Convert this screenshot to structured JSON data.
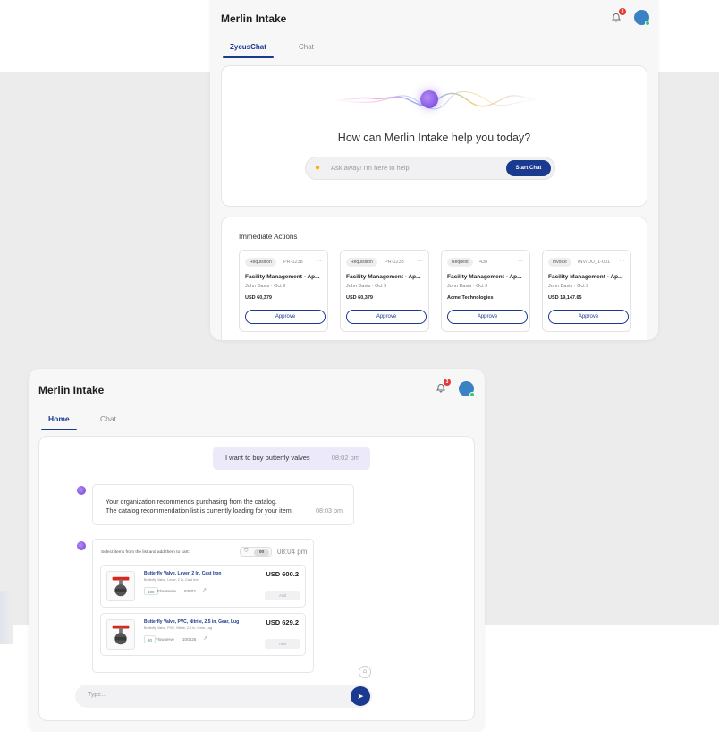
{
  "colors": {
    "accent": "#1a3a8f",
    "badge": "#e53935",
    "online": "#2ecc71",
    "avatar": "#3b82c4"
  },
  "window_a": {
    "title": "Merlin Intake",
    "notification_count": "3",
    "tabs": [
      {
        "label": "ZycusChat",
        "active": true
      },
      {
        "label": "Chat",
        "active": false
      }
    ],
    "hero": {
      "question": "How can Merlin Intake help you today?",
      "placeholder": "Ask away! I'm here to help",
      "start_label": "Start Chat"
    },
    "immediate_actions": {
      "title": "Immediate Actions",
      "cards": [
        {
          "tag": "Requisition",
          "ref": "PR-1238",
          "name": "Facility Management - Ap...",
          "meta": "John Davis · Oct 9",
          "amount": "USD 60,379",
          "approve": "Approve"
        },
        {
          "tag": "Requisition",
          "ref": "PR-1238",
          "name": "Facility Management - Ap...",
          "meta": "John Davis · Oct 9",
          "amount": "USD 60,379",
          "approve": "Approve"
        },
        {
          "tag": "Request",
          "ref": "438",
          "name": "Facility Management - Ap...",
          "meta": "John Davis · Oct 9",
          "amount": "Acme Technologies",
          "approve": "Approve"
        },
        {
          "tag": "Invoice",
          "ref": "INV/OU_1-001",
          "name": "Facility Management - Ap...",
          "meta": "John Davis · Oct 9",
          "amount": "USD 19,147.65",
          "approve": "Approve"
        }
      ]
    }
  },
  "window_b": {
    "title": "Merlin Intake",
    "notification_count": "3",
    "tabs": [
      {
        "label": "Home",
        "active": true
      },
      {
        "label": "Chat",
        "active": false
      }
    ],
    "messages": {
      "user": {
        "text": "I want to buy butterfly valves",
        "time": "08:02 pm"
      },
      "bot": {
        "line1": "Your organization recommends purchasing from the catalog.",
        "line2": "The catalog recommendation list is currently loading for your item.",
        "time": "08:03 pm"
      },
      "catalog": {
        "hint": "Select items from the list and add them to cart:",
        "cart_count": "00",
        "time": "08:04 pm",
        "items": [
          {
            "name": "Butterfly Valve, Lever, 2 In, Cast Iron",
            "desc": "Butterfly Valve, Lever, 2 In, Cast Iron",
            "qty": "100",
            "supplier": "Flowserve",
            "code": "93502",
            "price": "USD 600.2",
            "add": "Add"
          },
          {
            "name": "Butterfly Valve, PVC, Nitrile, 2.5 in, Gear, Lug",
            "desc": "Butterfly Valve, PVC, Nitrile, 2.5 in, Gear, Lug",
            "qty": "90",
            "supplier": "Flowserve",
            "code": "100425",
            "price": "USD 629.2",
            "add": "Add"
          }
        ]
      }
    },
    "input_placeholder": "Type..."
  },
  "icons": {
    "bell": "bell-icon",
    "bulb": "lightbulb-icon",
    "more": "more-horizontal-icon",
    "cart": "cart-icon",
    "external": "external-link-icon",
    "home": "home-icon",
    "send": "send-icon",
    "bot": "merlin-orb-icon"
  }
}
